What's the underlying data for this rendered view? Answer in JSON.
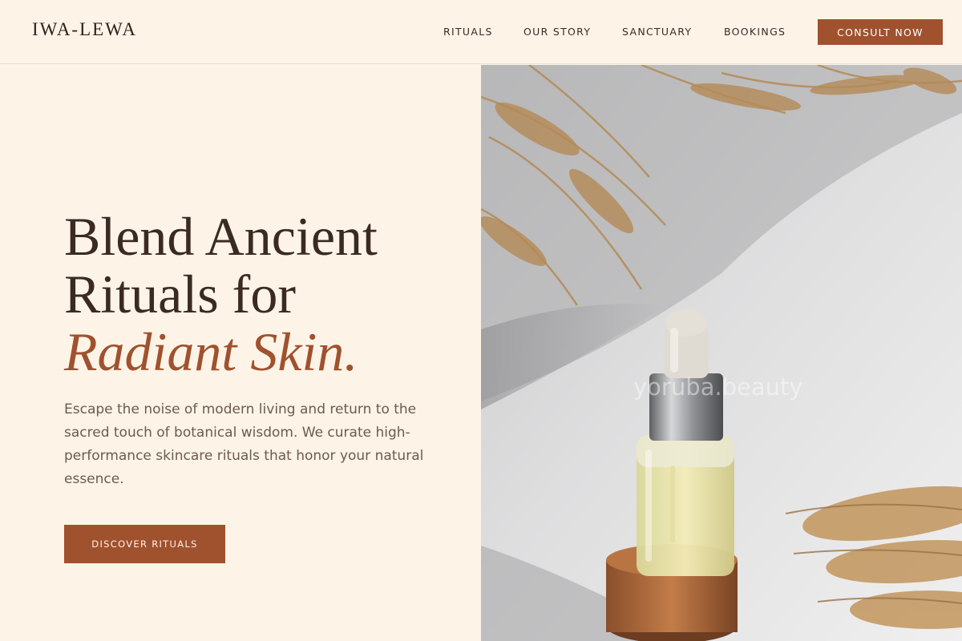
{
  "brand": {
    "logo": "IWA-LEWA"
  },
  "nav": {
    "items": [
      {
        "label": "RITUALS"
      },
      {
        "label": "OUR STORY"
      },
      {
        "label": "SANCTUARY"
      },
      {
        "label": "BOOKINGS"
      }
    ],
    "cta": "CONSULT NOW"
  },
  "hero": {
    "headline_line1": "Blend Ancient",
    "headline_line2": "Rituals for",
    "headline_accent": "Radiant Skin.",
    "lead": "Escape the noise of modern living and return to the sacred touch of botanical wisdom. We curate high-performance skincare rituals that honor your natural essence.",
    "button": "DISCOVER RITUALS",
    "image_watermark": "yoruba.beauty"
  },
  "colors": {
    "background": "#fdf4e7",
    "accent": "#a0512e",
    "text": "#3b2a22"
  }
}
